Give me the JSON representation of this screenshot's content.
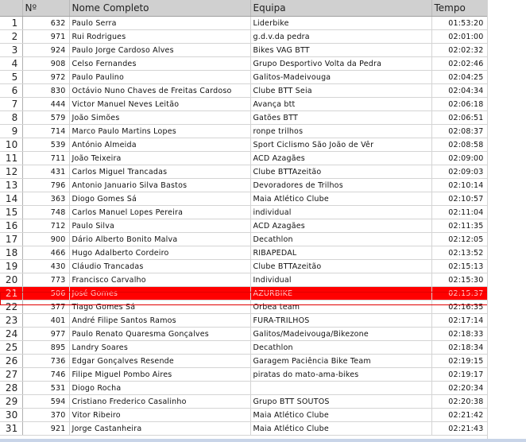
{
  "columns": {
    "number": "Nº",
    "name": "Nome Completo",
    "team": "Equipa",
    "time": "Tempo"
  },
  "rows": [
    {
      "pos": "1",
      "num": "632",
      "name": "Paulo Serra",
      "team": "Liderbike",
      "time": "01:53:20"
    },
    {
      "pos": "2",
      "num": "971",
      "name": "Rui Rodrigues",
      "team": "g.d.v.da pedra",
      "time": "02:01:00"
    },
    {
      "pos": "3",
      "num": "924",
      "name": "Paulo Jorge Cardoso Alves",
      "team": "Bikes VAG BTT",
      "time": "02:02:32"
    },
    {
      "pos": "4",
      "num": "908",
      "name": "Celso Fernandes",
      "team": "Grupo Desportivo Volta da Pedra",
      "time": "02:02:46"
    },
    {
      "pos": "5",
      "num": "972",
      "name": "Paulo Paulino",
      "team": "Galitos-Madeivouga",
      "time": "02:04:25"
    },
    {
      "pos": "6",
      "num": "830",
      "name": "Octávio Nuno Chaves de Freitas Cardoso",
      "team": "Clube BTT Seia",
      "time": "02:04:34"
    },
    {
      "pos": "7",
      "num": "444",
      "name": "Victor Manuel Neves Leitão",
      "team": "Avança btt",
      "time": "02:06:18"
    },
    {
      "pos": "8",
      "num": "579",
      "name": "João Simões",
      "team": "Gatões BTT",
      "time": "02:06:51"
    },
    {
      "pos": "9",
      "num": "714",
      "name": "Marco Paulo Martins Lopes",
      "team": "ronpe trilhos",
      "time": "02:08:37"
    },
    {
      "pos": "10",
      "num": "539",
      "name": "António Almeida",
      "team": "Sport Ciclismo São João de Vêr",
      "time": "02:08:58"
    },
    {
      "pos": "11",
      "num": "711",
      "name": "João Teixeira",
      "team": "ACD Azagães",
      "time": "02:09:00"
    },
    {
      "pos": "12",
      "num": "431",
      "name": "Carlos Miguel Trancadas",
      "team": "Clube BTTAzeitão",
      "time": "02:09:03"
    },
    {
      "pos": "13",
      "num": "796",
      "name": "Antonio Januario Silva Bastos",
      "team": "Devoradores de Trilhos",
      "time": "02:10:14"
    },
    {
      "pos": "14",
      "num": "363",
      "name": "Diogo Gomes Sá",
      "team": "Maia Atlético Clube",
      "time": "02:10:57"
    },
    {
      "pos": "15",
      "num": "748",
      "name": "Carlos Manuel Lopes Pereira",
      "team": "individual",
      "time": "02:11:04"
    },
    {
      "pos": "16",
      "num": "712",
      "name": "Paulo Silva",
      "team": "ACD Azagães",
      "time": "02:11:35"
    },
    {
      "pos": "17",
      "num": "900",
      "name": "Dário Alberto Bonito Malva",
      "team": "Decathlon",
      "time": "02:12:05"
    },
    {
      "pos": "18",
      "num": "466",
      "name": "Hugo Adalberto Cordeiro",
      "team": "RIBAPEDAL",
      "time": "02:13:52"
    },
    {
      "pos": "19",
      "num": "430",
      "name": "Cláudio Trancadas",
      "team": "Clube BTTAzeitão",
      "time": "02:15:13"
    },
    {
      "pos": "20",
      "num": "773",
      "name": "Francisco Carvalho",
      "team": "Individual",
      "time": "02:15:30"
    },
    {
      "pos": "21",
      "num": "506",
      "name": "José Gomes",
      "team": "AZURBIKE",
      "time": "02:15:37",
      "highlight": true
    },
    {
      "pos": "22",
      "num": "377",
      "name": "Tiago Gomes Sá",
      "team": "Orbea team",
      "time": "02:16:35"
    },
    {
      "pos": "23",
      "num": "401",
      "name": "André Filipe Santos Ramos",
      "team": "FURA-TRILHOS",
      "time": "02:17:14"
    },
    {
      "pos": "24",
      "num": "977",
      "name": "Paulo Renato Quaresma Gonçalves",
      "team": "Galitos/Madeivouga/Bikezone",
      "time": "02:18:33"
    },
    {
      "pos": "25",
      "num": "895",
      "name": "Landry Soares",
      "team": "Decathlon",
      "time": "02:18:34"
    },
    {
      "pos": "26",
      "num": "736",
      "name": "Edgar Gonçalves Resende",
      "team": "Garagem Paciência Bike Team",
      "time": "02:19:15"
    },
    {
      "pos": "27",
      "num": "746",
      "name": "Filipe Miguel Pombo Aires",
      "team": "piratas do mato-ama-bikes",
      "time": "02:19:17"
    },
    {
      "pos": "28",
      "num": "531",
      "name": "Diogo Rocha",
      "team": "",
      "time": "02:20:34"
    },
    {
      "pos": "29",
      "num": "594",
      "name": "Cristiano Frederico Casalinho",
      "team": "Grupo BTT SOUTOS",
      "time": "02:20:38"
    },
    {
      "pos": "30",
      "num": "370",
      "name": "Vitor Ribeiro",
      "team": "Maia Atlético Clube",
      "time": "02:21:42"
    },
    {
      "pos": "31",
      "num": "921",
      "name": "Jorge Castanheira",
      "team": "Maia Atlético Clube",
      "time": "02:21:43"
    }
  ],
  "colors": {
    "header_bg": "#d0d0d0",
    "highlight_bg": "#ff0000",
    "gridline": "#d4d4d4"
  }
}
